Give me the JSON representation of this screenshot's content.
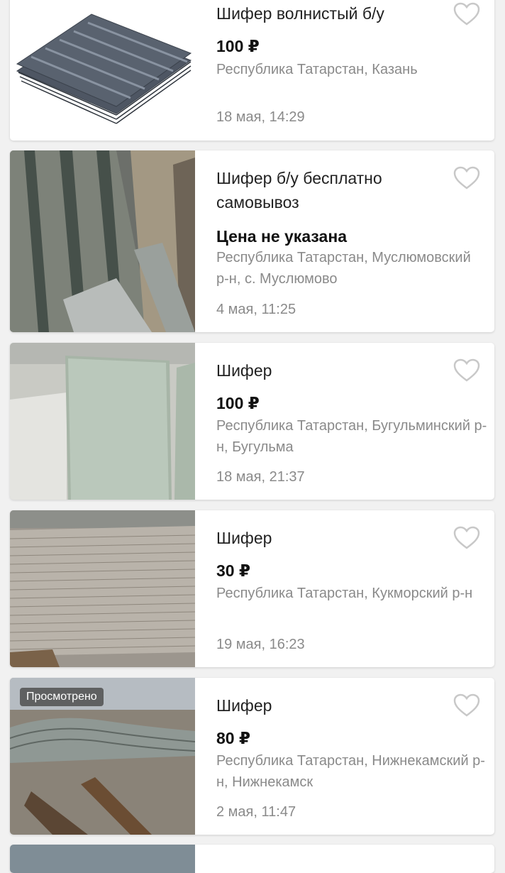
{
  "listings": [
    {
      "title": "Шифер волнистый б/у",
      "price": "100 ₽",
      "location": "Республика Татарстан, Казань",
      "date": "18 мая, 14:29",
      "image": "corrugated-slate-stack"
    },
    {
      "title": "Шифер б/у бесплатно самовывоз",
      "price": "Цена не указана",
      "location": "Республика Татарстан, Муслюмовский р-н, с. Муслюмово",
      "date": "4 мая, 11:25",
      "image": "used-slate-sheets"
    },
    {
      "title": "Шифер",
      "price": "100 ₽",
      "location": "Республика Татарстан, Бугульминский р-н, Бугульма",
      "date": "18 мая, 21:37",
      "image": "flat-slate-panels"
    },
    {
      "title": "Шифер",
      "price": "30 ₽",
      "location": "Республика Татарстан, Кукморский р-н",
      "date": "19 мая, 16:23",
      "image": "flat-slate-pallet"
    },
    {
      "title": "Шифер",
      "price": "80 ₽",
      "location": "Республика Татарстан, Нижнекамский р-н, Нижнекамск",
      "date": "2 мая, 11:47",
      "image": "wavy-slate-outdoor",
      "badge": "Просмотрено"
    }
  ],
  "icons": {
    "favorite": "heart-outline-icon"
  },
  "colors": {
    "text": "#222222",
    "secondary": "#8a8a8a",
    "heart": "#c8c8c8",
    "background": "#f1f1f1"
  }
}
